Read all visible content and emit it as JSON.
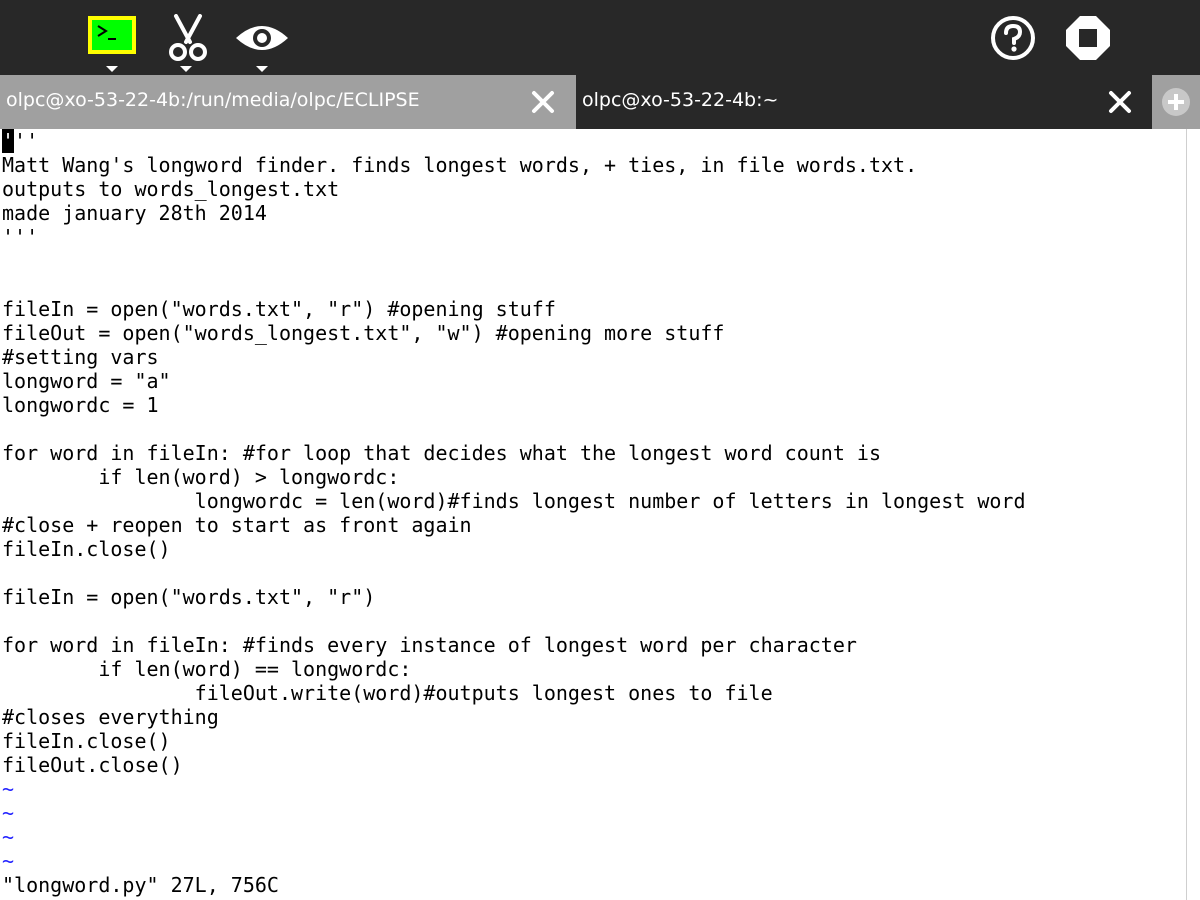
{
  "toolbar": {
    "items": [
      {
        "name": "terminal-activity-icon"
      },
      {
        "name": "scissors-icon"
      },
      {
        "name": "eye-icon"
      }
    ],
    "help_icon": "help-icon",
    "stop_icon": "stop-icon"
  },
  "tabs": [
    {
      "label": "olpc@xo-53-22-4b:/run/media/olpc/ECLIPSE",
      "active": true
    },
    {
      "label": "olpc@xo-53-22-4b:~",
      "active": false
    }
  ],
  "terminal": {
    "cursor_char": "'",
    "first_line_rest": "''",
    "lines": [
      "Matt Wang's longword finder. finds longest words, + ties, in file words.txt.",
      "outputs to words_longest.txt",
      "made january 28th 2014",
      "'''",
      "",
      "",
      "fileIn = open(\"words.txt\", \"r\") #opening stuff",
      "fileOut = open(\"words_longest.txt\", \"w\") #opening more stuff",
      "#setting vars",
      "longword = \"a\"",
      "longwordc = 1",
      "",
      "for word in fileIn: #for loop that decides what the longest word count is",
      "        if len(word) > longwordc:",
      "                longwordc = len(word)#finds longest number of letters in longest word",
      "#close + reopen to start as front again",
      "fileIn.close()",
      "",
      "fileIn = open(\"words.txt\", \"r\")",
      "",
      "for word in fileIn: #finds every instance of longest word per character",
      "        if len(word) == longwordc:",
      "                fileOut.write(word)#outputs longest ones to file",
      "#closes everything",
      "fileIn.close()",
      "fileOut.close()"
    ],
    "tildes": [
      "~",
      "~",
      "~",
      "~"
    ],
    "status_line": "\"longword.py\" 27L, 756C"
  },
  "colors": {
    "toolbar_bg": "#282828",
    "active_tab_bg": "#a0a0a0",
    "terminal_bg": "#ffffff",
    "tilde": "#2424ff",
    "terminal_icon_fill": "#00ff00",
    "terminal_icon_border": "#ffff00"
  }
}
